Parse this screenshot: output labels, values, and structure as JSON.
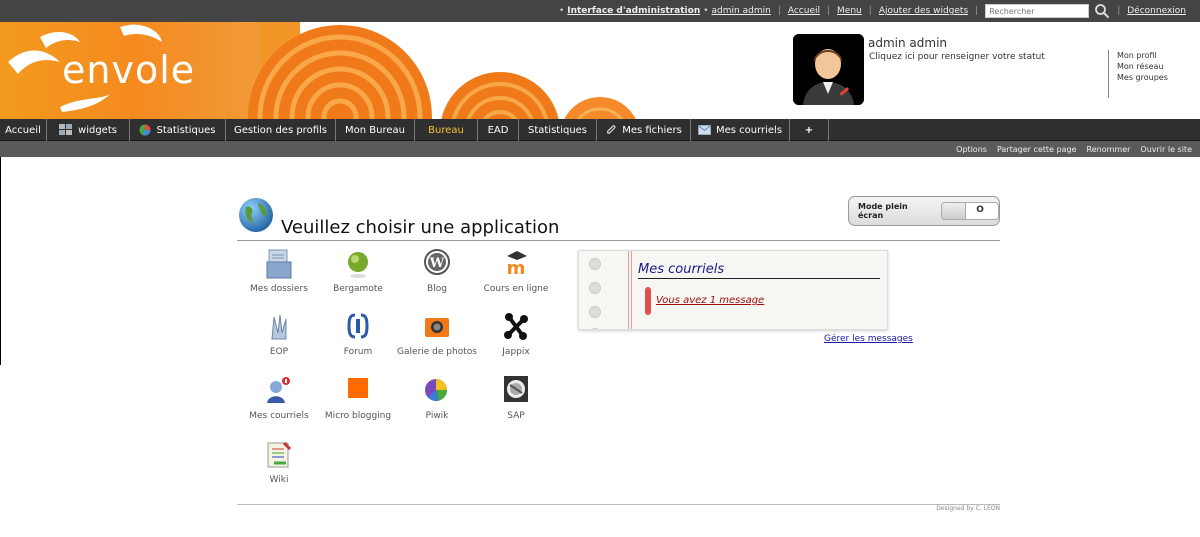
{
  "topbar": {
    "admin_interface": "Interface d'administration",
    "user_link": "admin admin",
    "links": [
      "Accueil",
      "Menu",
      "Ajouter des widgets"
    ],
    "search_placeholder": "Rechercher",
    "logout": "Déconnexion"
  },
  "banner": {
    "logo_text": "envole",
    "user_name": "admin admin",
    "status_prompt": "Cliquez ici pour renseigner votre statut",
    "profile_links": [
      "Mon profil",
      "Mon réseau",
      "Mes groupes"
    ]
  },
  "nav": {
    "items": [
      "Accueil",
      "widgets",
      "Statistiques",
      "Gestion des profils",
      "Mon Bureau",
      "Bureau",
      "EAD",
      "Statistiques",
      "Mes fichiers",
      "Mes courriels",
      "+"
    ],
    "active": "Bureau"
  },
  "subnav": {
    "items": [
      "Options",
      "Partager cette page",
      "Renommer",
      "Ouvrir le site"
    ]
  },
  "main": {
    "title": "Veuillez choisir une application",
    "fullscreen_label": "Mode plein écran",
    "fullscreen_state": "O",
    "apps": [
      {
        "label": "Mes dossiers",
        "icon": "folder-icon"
      },
      {
        "label": "Bergamote",
        "icon": "bergamote-icon"
      },
      {
        "label": "Blog",
        "icon": "wordpress-icon"
      },
      {
        "label": "Cours en ligne",
        "icon": "moodle-icon"
      },
      {
        "label": "EOP",
        "icon": "eop-icon"
      },
      {
        "label": "Forum",
        "icon": "forum-icon"
      },
      {
        "label": "Galerie de photos",
        "icon": "camera-icon"
      },
      {
        "label": "Jappix",
        "icon": "jappix-icon"
      },
      {
        "label": "Mes courriels",
        "icon": "mail-user-icon"
      },
      {
        "label": "Micro blogging",
        "icon": "microblog-icon"
      },
      {
        "label": "Piwik",
        "icon": "piwik-pie-icon"
      },
      {
        "label": "SAP",
        "icon": "sap-icon"
      },
      {
        "label": "Wiki",
        "icon": "wiki-icon"
      }
    ]
  },
  "mail_widget": {
    "title": "Mes courriels",
    "message": "Vous avez 1 message",
    "manage": "Gérer les messages"
  },
  "footer": {
    "credit": "Designed by C. LEON"
  },
  "colors": {
    "topbar": "#444444",
    "nav": "#2f2f2f",
    "active_nav": "#f4c430",
    "brand_orange": "#f07a1a"
  }
}
